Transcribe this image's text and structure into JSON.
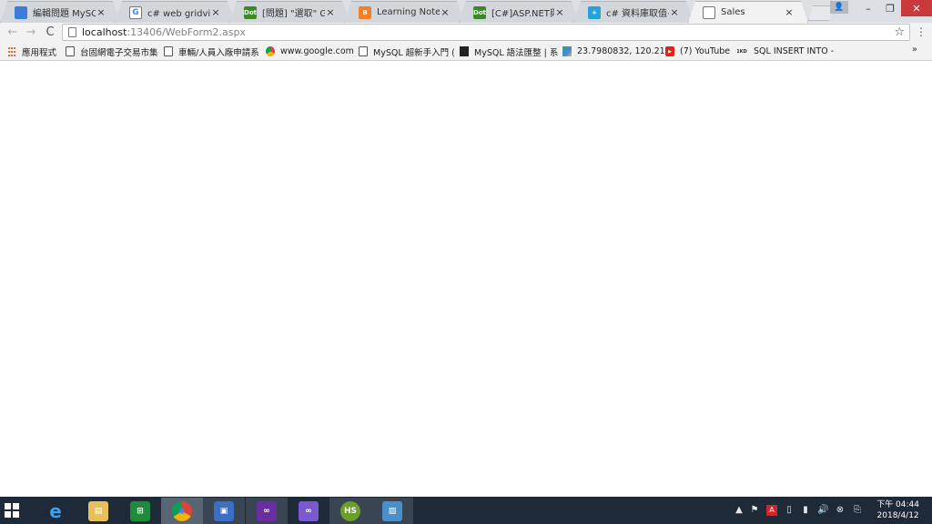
{
  "browser": {
    "tabs": [
      {
        "title": "編輯問題 MySQL 插",
        "favicon": "stackoverflow-icon",
        "color": "#3b7dd8",
        "glyph": ""
      },
      {
        "title": "c# web gridview 顯",
        "favicon": "google-icon",
        "color": "#ffffff",
        "glyph": "G"
      },
      {
        "title": "[問題] \"選取\" Gridv",
        "favicon": "dotnet-icon",
        "color": "#3a8a2a",
        "glyph": "Dot"
      },
      {
        "title": "Learning Notes: [C",
        "favicon": "blogger-icon",
        "color": "#f0812a",
        "glyph": "B"
      },
      {
        "title": "[C#]ASP.NET與資料",
        "favicon": "dotnet-icon",
        "color": "#3a8a2a",
        "glyph": "Dot"
      },
      {
        "title": "c# 資料庫取值+顯示",
        "favicon": "plus-icon",
        "color": "#28a0d8",
        "glyph": "+"
      },
      {
        "title": "Sales",
        "favicon": "page-icon",
        "color": "#ffffff",
        "glyph": ""
      }
    ],
    "active_tab_index": 6,
    "tab_close_glyph": "×",
    "window_controls": {
      "profile": "👤",
      "minimize": "–",
      "restore": "❐",
      "close": "✕"
    },
    "nav": {
      "back": "←",
      "forward": "→",
      "reload": "C"
    },
    "url_host": "localhost",
    "url_path": ":13406/WebForm2.aspx",
    "star": "☆",
    "menu": "⋮",
    "bookmarks": [
      {
        "label": "應用程式",
        "icon": "apps-icon"
      },
      {
        "label": "台固網電子交易市集",
        "icon": "page-icon"
      },
      {
        "label": "車輛/人員入廠申請系",
        "icon": "page-icon"
      },
      {
        "label": "www.google.com",
        "icon": "chrome-icon"
      },
      {
        "label": "MySQL 超新手入門 (",
        "icon": "page-icon"
      },
      {
        "label": "MySQL 語法匯整 | 系",
        "icon": "terminal-icon"
      },
      {
        "label": "23.7980832, 120.21",
        "icon": "maps-icon"
      },
      {
        "label": "(7) YouTube",
        "icon": "youtube-icon"
      },
      {
        "label": "SQL INSERT INTO -",
        "icon": "1kd-icon"
      }
    ],
    "bookmarks_overflow": "»"
  },
  "taskbar": {
    "apps": [
      {
        "name": "internet-explorer",
        "glyph": "e",
        "color": "#1e8fe0",
        "state": "none"
      },
      {
        "name": "file-explorer",
        "glyph": "▤",
        "color": "#e8c05a",
        "state": "none"
      },
      {
        "name": "store",
        "glyph": "⊞",
        "color": "#1e8b3a",
        "state": "none"
      },
      {
        "name": "chrome",
        "glyph": "◉",
        "color": "#d44a3a",
        "state": "active"
      },
      {
        "name": "remote-desktop",
        "glyph": "▣",
        "color": "#3b6fc4",
        "state": "running"
      },
      {
        "name": "visual-studio",
        "glyph": "∞",
        "color": "#6a2ea0",
        "state": "running"
      },
      {
        "name": "visual-studio-2",
        "glyph": "∞",
        "color": "#7a5ad0",
        "state": "none"
      },
      {
        "name": "heidisql",
        "glyph": "HS",
        "color": "#6aa02a",
        "state": "running"
      },
      {
        "name": "photos",
        "glyph": "▨",
        "color": "#4a90c8",
        "state": "running"
      }
    ],
    "tray": [
      "▲",
      "⚑",
      "A",
      "▯",
      "▮",
      "🔊",
      "⊗",
      "⎘"
    ],
    "clock_time": "下午 04:44",
    "clock_date": "2018/4/12"
  }
}
